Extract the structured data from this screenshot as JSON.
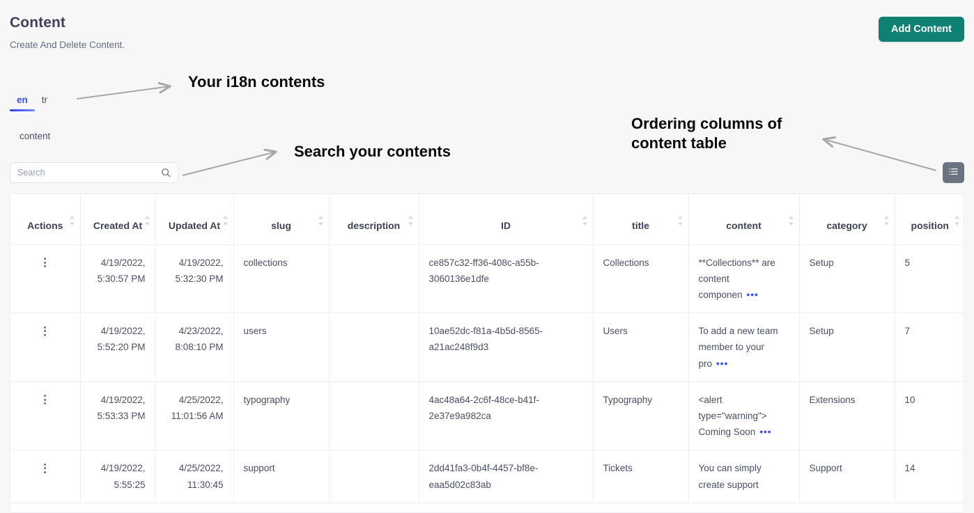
{
  "header": {
    "title": "Content",
    "subtitle": "Create And Delete Content.",
    "add_button": "Add Content",
    "accent_color": "#0f8173"
  },
  "locale_tabs": {
    "items": [
      {
        "label": "en",
        "active": true
      },
      {
        "label": "tr",
        "active": false
      }
    ],
    "active_color": "#3d4ff0",
    "subtab": "content"
  },
  "search": {
    "placeholder": "Search",
    "value": "",
    "icon": "search-icon"
  },
  "column_order_button": {
    "icon": "list-columns-icon",
    "background": "#6b7280"
  },
  "annotations": [
    {
      "id": "i18n",
      "text": "Your i18n contents"
    },
    {
      "id": "search",
      "text": "Search your contents"
    },
    {
      "id": "order",
      "text": "Ordering columns of\ncontent table"
    }
  ],
  "table": {
    "columns": [
      {
        "key": "actions",
        "label": "Actions",
        "sortable": true,
        "align": "center"
      },
      {
        "key": "created_at",
        "label": "Created At",
        "sortable": true,
        "align": "right"
      },
      {
        "key": "updated_at",
        "label": "Updated At",
        "sortable": true,
        "align": "right"
      },
      {
        "key": "slug",
        "label": "slug",
        "sortable": true,
        "align": "left"
      },
      {
        "key": "description",
        "label": "description",
        "sortable": true,
        "align": "left"
      },
      {
        "key": "id",
        "label": "ID",
        "sortable": true,
        "align": "left"
      },
      {
        "key": "title",
        "label": "title",
        "sortable": true,
        "align": "left"
      },
      {
        "key": "content",
        "label": "content",
        "sortable": true,
        "align": "left"
      },
      {
        "key": "category",
        "label": "category",
        "sortable": true,
        "align": "left"
      },
      {
        "key": "position",
        "label": "position",
        "sortable": true,
        "align": "left"
      }
    ],
    "rows": [
      {
        "created_at": "4/19/2022, 5:30:57 PM",
        "updated_at": "4/19/2022, 5:32:30 PM",
        "slug": "collections",
        "description": "",
        "id": "ce857c32-ff36-408c-a55b-3060136e1dfe",
        "title": "Collections",
        "content": "**Collections** are content componen",
        "content_truncated": true,
        "category": "Setup",
        "position": "5"
      },
      {
        "created_at": "4/19/2022, 5:52:20 PM",
        "updated_at": "4/23/2022, 8:08:10 PM",
        "slug": "users",
        "description": "",
        "id": "10ae52dc-f81a-4b5d-8565-a21ac248f9d3",
        "title": "Users",
        "content": "To add a new team member to your pro",
        "content_truncated": true,
        "category": "Setup",
        "position": "7"
      },
      {
        "created_at": "4/19/2022, 5:53:33 PM",
        "updated_at": "4/25/2022, 11:01:56 AM",
        "slug": "typography",
        "description": "",
        "id": "4ac48a64-2c6f-48ce-b41f-2e37e9a982ca",
        "title": "Typography",
        "content": "<alert type=\"warning\"> Coming Soon",
        "content_truncated": true,
        "category": "Extensions",
        "position": "10"
      },
      {
        "created_at": "4/19/2022, 5:55:25",
        "updated_at": "4/25/2022, 11:30:45",
        "slug": "support",
        "description": "",
        "id": "2dd41fa3-0b4f-4457-bf8e-eaa5d02c83ab",
        "title": "Tickets",
        "content": "You can simply create support",
        "content_truncated": false,
        "category": "Support",
        "position": "14"
      }
    ],
    "truncate_marker": "•••"
  }
}
